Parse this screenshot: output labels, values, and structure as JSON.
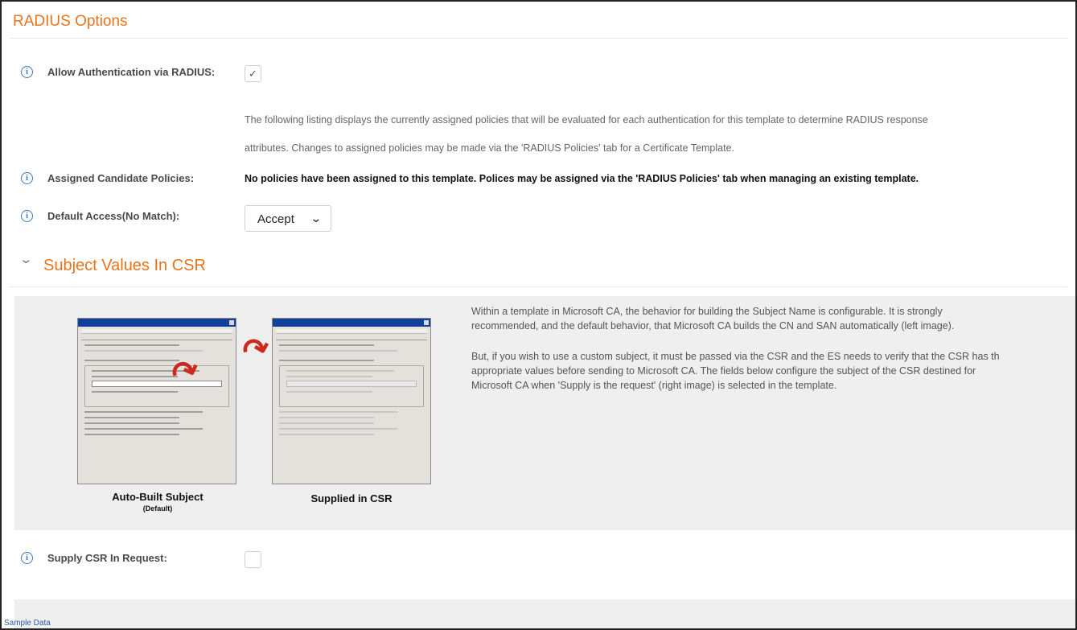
{
  "radius": {
    "title": "RADIUS Options",
    "allow_auth_label": "Allow Authentication via RADIUS:",
    "allow_auth_checked": true,
    "allow_auth_mark": "✓",
    "policy_desc_line1": "The following listing displays the currently assigned policies that will be evaluated for each authentication for this template to determine RADIUS response",
    "policy_desc_line2": "attributes. Changes to assigned policies may be made via the 'RADIUS Policies' tab for a Certificate Template.",
    "assigned_label": "Assigned Candidate Policies:",
    "assigned_message": "No policies have been assigned to this template. Polices may be assigned via the 'RADIUS Policies' tab when managing an existing template.",
    "default_access_label": "Default Access(No Match):",
    "default_access_value": "Accept",
    "default_access_chevron": "⌄"
  },
  "subject": {
    "collapse_icon": "chevron-down",
    "collapse_glyph": "⌄",
    "title": "Subject Values In CSR",
    "image_left_caption": "Auto-Built Subject",
    "image_left_subcaption": "(Default)",
    "image_right_caption": "Supplied in CSR",
    "para1_line1": "Within a template in Microsoft CA, the behavior for building the Subject Name is configurable. It is strongly",
    "para1_line2": "recommended, and the default behavior, that Microsoft CA builds the CN and SAN automatically (left image).",
    "para2_line1": "But, if you wish to use a custom subject, it must be passed via the CSR and the ES needs to verify that the CSR has th",
    "para2_line2": "appropriate values before sending to Microsoft CA. The fields below configure the subject of the CSR destined for",
    "para2_line3": "Microsoft CA when 'Supply is the request' (right image) is selected in the template.",
    "supply_csr_label": "Supply CSR In Request:",
    "supply_csr_checked": false
  },
  "footer": {
    "link": "Sample Data"
  },
  "icons": {
    "info": "info-icon",
    "info_glyph": "i"
  },
  "colors": {
    "accent": "#e8731c",
    "info": "#3a78c2",
    "panel": "#efefef"
  }
}
